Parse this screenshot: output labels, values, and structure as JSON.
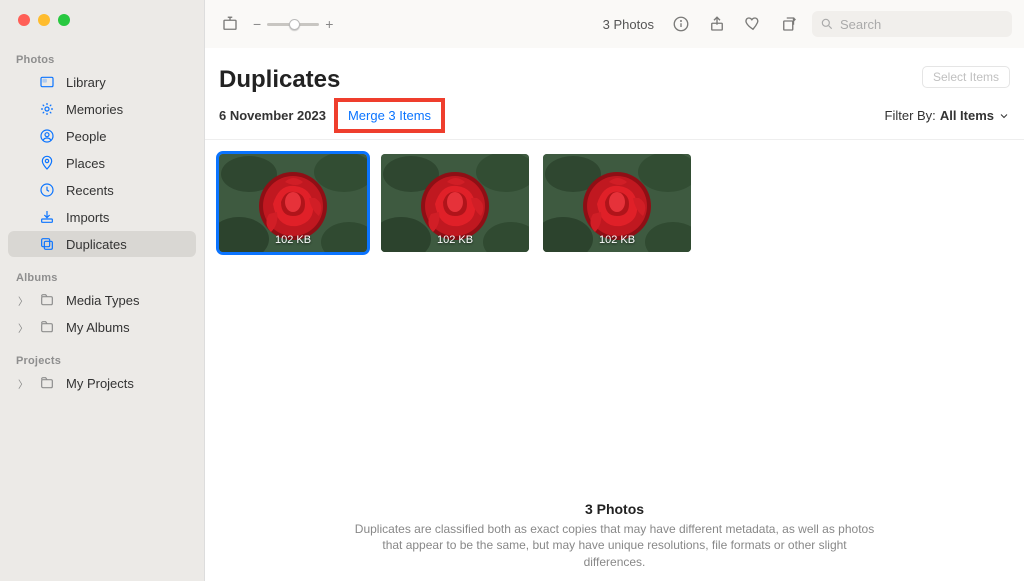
{
  "sidebar": {
    "sections": [
      {
        "label": "Photos",
        "items": [
          {
            "icon": "library",
            "color": "#0b74ff",
            "label": "Library",
            "chev": false
          },
          {
            "icon": "memories",
            "color": "#0b74ff",
            "label": "Memories",
            "chev": false
          },
          {
            "icon": "people",
            "color": "#0b74ff",
            "label": "People",
            "chev": false
          },
          {
            "icon": "places",
            "color": "#0b74ff",
            "label": "Places",
            "chev": false
          },
          {
            "icon": "recents",
            "color": "#0b74ff",
            "label": "Recents",
            "chev": false
          },
          {
            "icon": "imports",
            "color": "#0b74ff",
            "label": "Imports",
            "chev": false
          },
          {
            "icon": "duplicates",
            "color": "#0b74ff",
            "label": "Duplicates",
            "chev": false,
            "selected": true
          }
        ]
      },
      {
        "label": "Albums",
        "items": [
          {
            "icon": "folder",
            "color": "#8e8e8e",
            "label": "Media Types",
            "chev": true
          },
          {
            "icon": "folder",
            "color": "#8e8e8e",
            "label": "My Albums",
            "chev": true
          }
        ]
      },
      {
        "label": "Projects",
        "items": [
          {
            "icon": "folder",
            "color": "#8e8e8e",
            "label": "My Projects",
            "chev": true
          }
        ]
      }
    ]
  },
  "toolbar": {
    "count": "3 Photos",
    "search_placeholder": "Search"
  },
  "header": {
    "title": "Duplicates",
    "select_items": "Select Items",
    "date": "6 November 2023",
    "merge": "Merge 3 Items",
    "filter_label": "Filter By:",
    "filter_value": "All Items"
  },
  "thumbnails": [
    {
      "size": "102 KB",
      "selected": true
    },
    {
      "size": "102 KB",
      "selected": false
    },
    {
      "size": "102 KB",
      "selected": false
    }
  ],
  "footer": {
    "heading": "3 Photos",
    "body": "Duplicates are classified both as exact copies that may have different metadata, as well as photos that appear to be the same, but may have unique resolutions, file formats or other slight differences."
  }
}
